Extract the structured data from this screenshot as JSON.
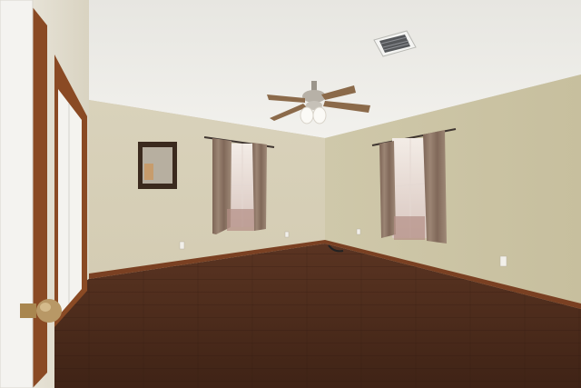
{
  "scene": {
    "kind": "photo",
    "subject": "empty-bedroom",
    "elements": [
      "textured-ceiling",
      "ceiling-fan",
      "hvac-vent",
      "wall-mirror",
      "left-window-with-curtains",
      "right-window-with-curtains",
      "closet-door",
      "entry-door",
      "wood-floor",
      "baseboards",
      "wall-outlets"
    ]
  },
  "colors": {
    "ceiling": "#ecebe6",
    "wall_left": "#d6ceb6",
    "wall_right": "#ccc5a6",
    "floor": "#4a2a1b",
    "trim": "#8a4a24",
    "curtain": "#8b7060",
    "door": "#f4f3f0"
  }
}
